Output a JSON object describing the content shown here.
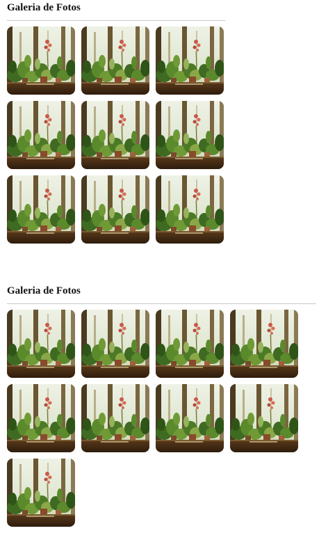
{
  "galleries": [
    {
      "title": "Galeria de Fotos",
      "photo_count": 9,
      "columns": 3
    },
    {
      "title": "Galeria de Fotos",
      "photo_count": 9,
      "columns": 4
    }
  ],
  "photo": {
    "subject": "window-plants-photo"
  }
}
